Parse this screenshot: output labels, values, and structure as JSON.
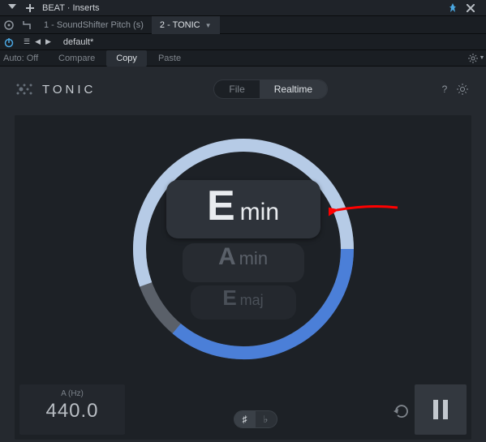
{
  "window": {
    "title": "BEAT · Inserts"
  },
  "tabs": {
    "tab1": "1 - SoundShifter Pitch (s)",
    "tab2": "2 - TONIC"
  },
  "preset": {
    "name": "default*"
  },
  "actions": {
    "auto_label": "Auto:",
    "auto_value": "Off",
    "compare": "Compare",
    "copy": "Copy",
    "paste": "Paste"
  },
  "plugin": {
    "brand": "TONIC",
    "mode": {
      "file": "File",
      "realtime": "Realtime"
    }
  },
  "keys": {
    "primary": {
      "note": "E",
      "scale": "min"
    },
    "secondary": {
      "note": "A",
      "scale": "min"
    },
    "tertiary": {
      "note": "E",
      "scale": "maj"
    }
  },
  "tuning": {
    "label": "A (Hz)",
    "value": "440.0"
  },
  "accidental": {
    "sharp": "♯",
    "flat": "♭"
  },
  "colors": {
    "ring_light": "#b6cbe6",
    "ring_dark": "#5a6069",
    "ring_blue": "#4b7fd8"
  }
}
